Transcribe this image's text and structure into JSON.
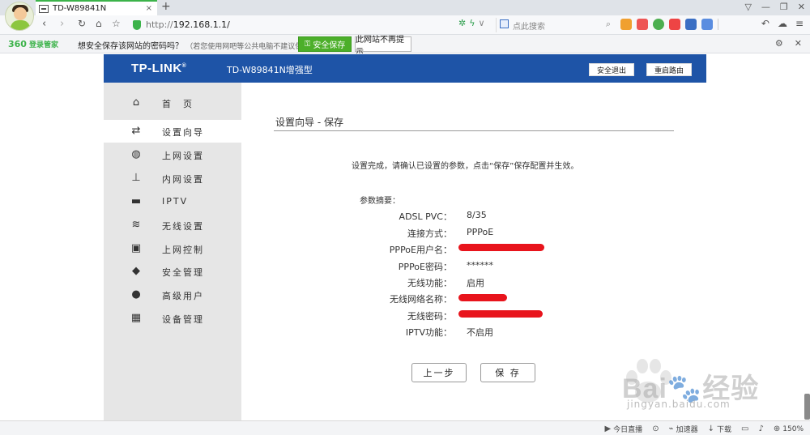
{
  "browser": {
    "tab_title": "TD-W89841N",
    "tab_close": "×",
    "new_tab": "+",
    "url_prefix": "http://",
    "url_host": "192.168.1.1/",
    "search_placeholder": "点此搜索",
    "window_controls": [
      "▽",
      "—",
      "❐",
      "✕"
    ],
    "accent_color": "#3cb34a"
  },
  "password_bar": {
    "brand": "360",
    "brand_sub": "登录管家",
    "question": "想安全保存该网站的密码吗？",
    "hint": "（若您使用网吧等公共电脑不建议保存）",
    "save_button": "安全保存",
    "never_button": "此网站不再提示"
  },
  "router": {
    "logo": "TP-LINK",
    "logo_mark": "®",
    "model": "TD-W89841N增强型",
    "logout_button": "安全退出",
    "reboot_button": "重启路由",
    "header_color": "#1e54a7",
    "menu": [
      {
        "label": "首　页",
        "icon": "home-icon",
        "active": false
      },
      {
        "label": "设置向导",
        "icon": "arrows-icon",
        "active": true
      },
      {
        "label": "上网设置",
        "icon": "globe-icon",
        "active": false
      },
      {
        "label": "内网设置",
        "icon": "network-icon",
        "active": false
      },
      {
        "label": "IPTV",
        "icon": "monitor-icon",
        "active": false
      },
      {
        "label": "无线设置",
        "icon": "wifi-icon",
        "active": false
      },
      {
        "label": "上网控制",
        "icon": "lock-icon",
        "active": false
      },
      {
        "label": "安全管理",
        "icon": "shield-icon",
        "active": false
      },
      {
        "label": "高级用户",
        "icon": "user-icon",
        "active": false
      },
      {
        "label": "设备管理",
        "icon": "grid-icon",
        "active": false
      }
    ],
    "section_title": "设置向导 - 保存",
    "description": "设置完成，请确认已设置的参数，点击“保存”保存配置并生效。",
    "summary_label": "参数摘要：",
    "params": [
      {
        "label": "ADSL PVC：",
        "value": "8/35",
        "redacted": false
      },
      {
        "label": "连接方式：",
        "value": "PPPoE",
        "redacted": false
      },
      {
        "label": "PPPoE用户名：",
        "value": "",
        "redacted": true
      },
      {
        "label": "PPPoE密码：",
        "value": "******",
        "redacted": false
      },
      {
        "label": "无线功能：",
        "value": "启用",
        "redacted": false
      },
      {
        "label": "无线网络名称：",
        "value": "",
        "redacted": true
      },
      {
        "label": "无线密码：",
        "value": "",
        "redacted": true
      },
      {
        "label": "IPTV功能：",
        "value": "不启用",
        "redacted": false
      }
    ],
    "prev_button": "上一步",
    "save_button": "保 存"
  },
  "watermark": {
    "text": "Bai🐾经验",
    "sub": "jingyan.baidu.com"
  },
  "statusbar": {
    "items": [
      "今日直播",
      "加速器",
      "下载",
      "150%"
    ]
  }
}
